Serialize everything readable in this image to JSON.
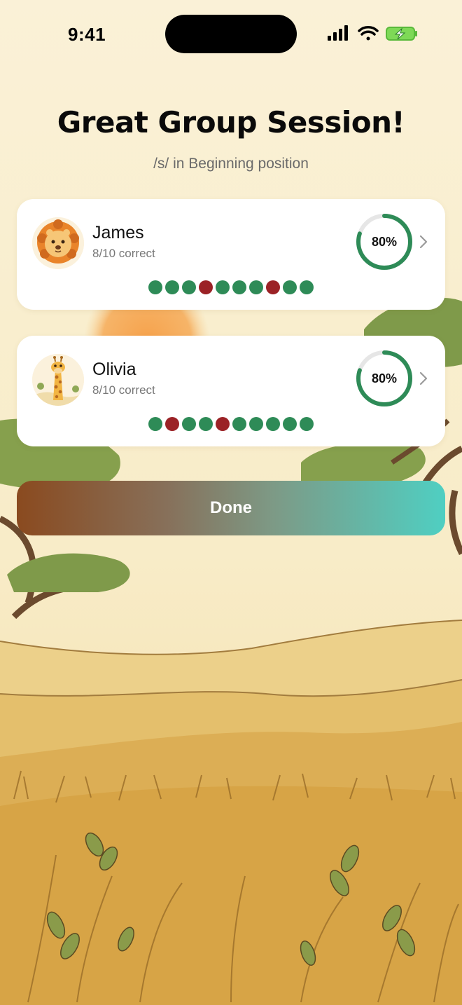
{
  "status_bar": {
    "time": "9:41",
    "icons": [
      "cellular-signal-icon",
      "wifi-icon",
      "battery-charging-icon"
    ]
  },
  "header": {
    "title": "Great Group Session!",
    "subtitle": "/s/ in Beginning position"
  },
  "students": [
    {
      "name": "James",
      "score": "8/10 correct",
      "percent_label": "80%",
      "progress": 0.8,
      "avatar_icon": "lion-avatar",
      "results": [
        true,
        true,
        true,
        false,
        true,
        true,
        true,
        false,
        true,
        true
      ]
    },
    {
      "name": "Olivia",
      "score": "8/10 correct",
      "percent_label": "80%",
      "progress": 0.8,
      "avatar_icon": "giraffe-avatar",
      "results": [
        true,
        false,
        true,
        true,
        false,
        true,
        true,
        true,
        true,
        true
      ]
    }
  ],
  "actions": {
    "done_label": "Done"
  },
  "colors": {
    "correct": "#2e8b57",
    "incorrect": "#9b2226",
    "ring_track": "#e6e6e6",
    "ring_fill": "#2e8b57",
    "button_gradient_start": "#8a4a1f",
    "button_gradient_end": "#4fcfc2"
  }
}
